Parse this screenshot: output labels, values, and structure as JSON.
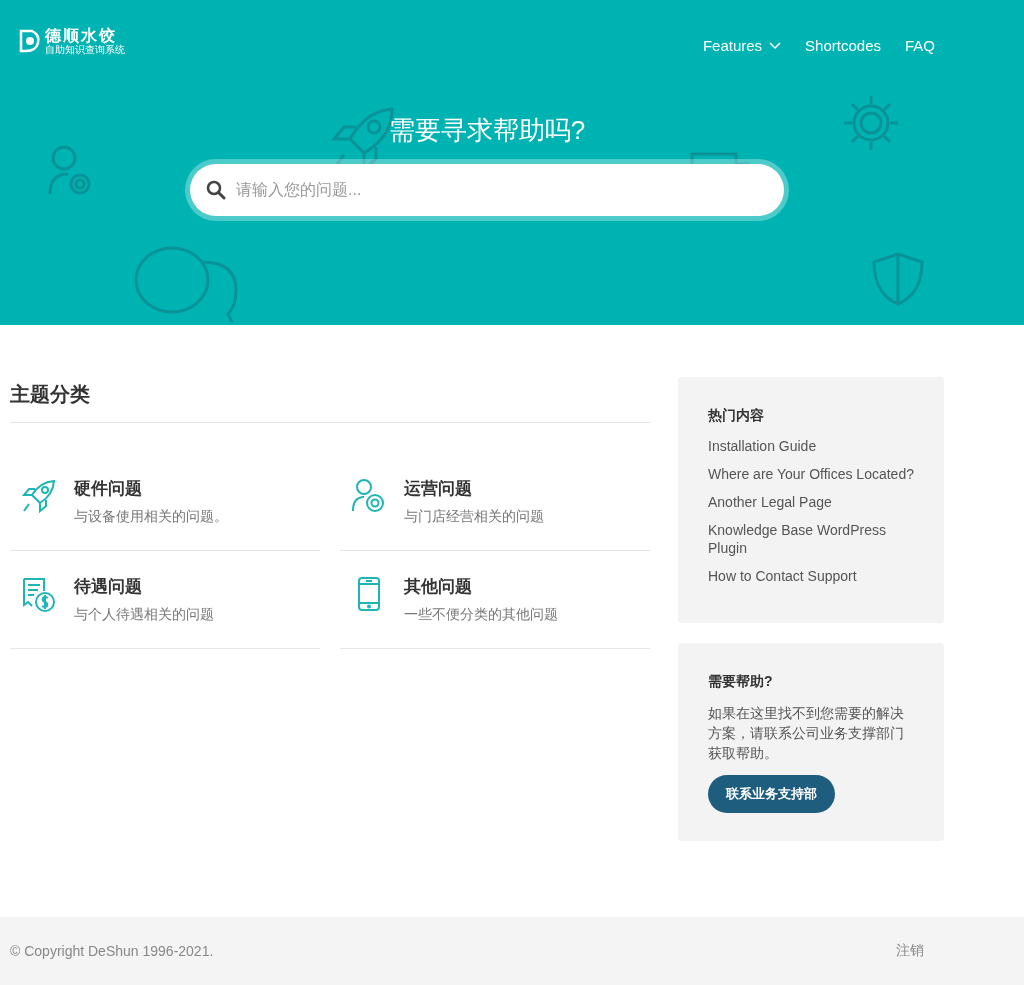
{
  "header": {
    "logo": {
      "name": "德顺水饺",
      "subtitle": "自助知识查询系统"
    },
    "nav": [
      {
        "label": "Features",
        "dropdown": true
      },
      {
        "label": "Shortcodes",
        "dropdown": false
      },
      {
        "label": "FAQ",
        "dropdown": false
      }
    ],
    "hero_title": "需要寻求帮助吗?",
    "search": {
      "placeholder": "请输入您的问题..."
    }
  },
  "topics": {
    "title": "主题分类",
    "items": [
      {
        "title": "硬件问题",
        "description": "与设备使用相关的问题。"
      },
      {
        "title": "运营问题",
        "description": "与门店经营相关的问题"
      },
      {
        "title": "待遇问题",
        "description": "与个人待遇相关的问题"
      },
      {
        "title": "其他问题",
        "description": "一些不便分类的其他问题"
      }
    ]
  },
  "popular": {
    "title": "热门内容",
    "links": [
      "Installation Guide",
      "Where are Your Offices Located?",
      "Another Legal Page",
      "Knowledge Base WordPress Plugin",
      "How to Contact Support"
    ]
  },
  "help": {
    "title": "需要帮助?",
    "text": "如果在这里找不到您需要的解决方案，请联系公司业务支撑部门获取帮助。",
    "button": "联系业务支持部"
  },
  "footer": {
    "copyright": "© Copyright DeShun 1996-2021.",
    "logout": "注销"
  }
}
